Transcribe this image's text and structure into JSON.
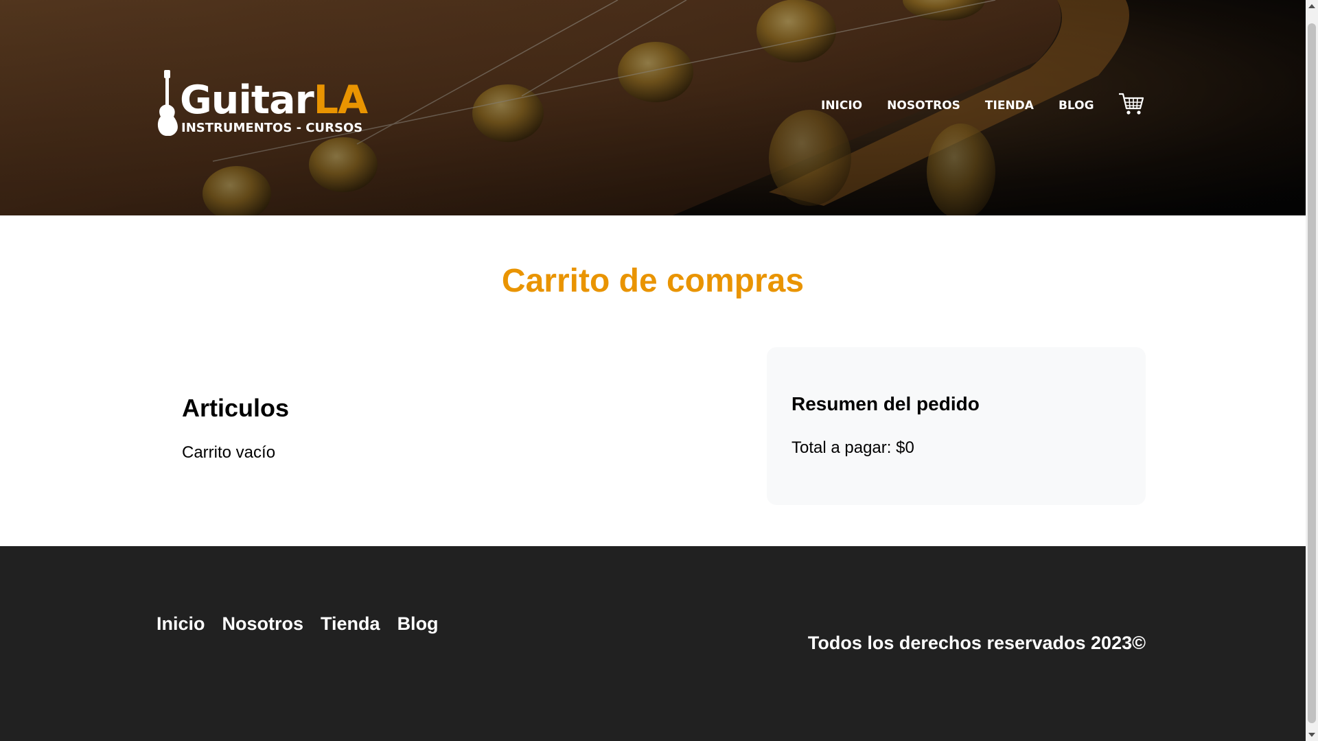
{
  "header": {
    "logo": {
      "word_main": "Guitar",
      "word_accent": "LA",
      "subtitle": "INSTRUMENTOS - CURSOS"
    },
    "nav": [
      {
        "label": "INICIO"
      },
      {
        "label": "NOSOTROS"
      },
      {
        "label": "TIENDA"
      },
      {
        "label": "BLOG"
      }
    ],
    "cart_icon": "shopping-cart-icon"
  },
  "main": {
    "title": "Carrito de compras",
    "articles": {
      "heading": "Articulos",
      "empty_text": "Carrito vacío"
    },
    "summary": {
      "heading": "Resumen del pedido",
      "total_text": "Total a pagar: $0"
    }
  },
  "footer": {
    "nav": [
      {
        "label": "Inicio"
      },
      {
        "label": "Nosotros"
      },
      {
        "label": "Tienda"
      },
      {
        "label": "Blog"
      }
    ],
    "copyright": "Todos los derechos reservados 2023©"
  },
  "colors": {
    "accent": "#e99401",
    "footer_bg": "#212121",
    "summary_bg": "#f8f9fa"
  }
}
